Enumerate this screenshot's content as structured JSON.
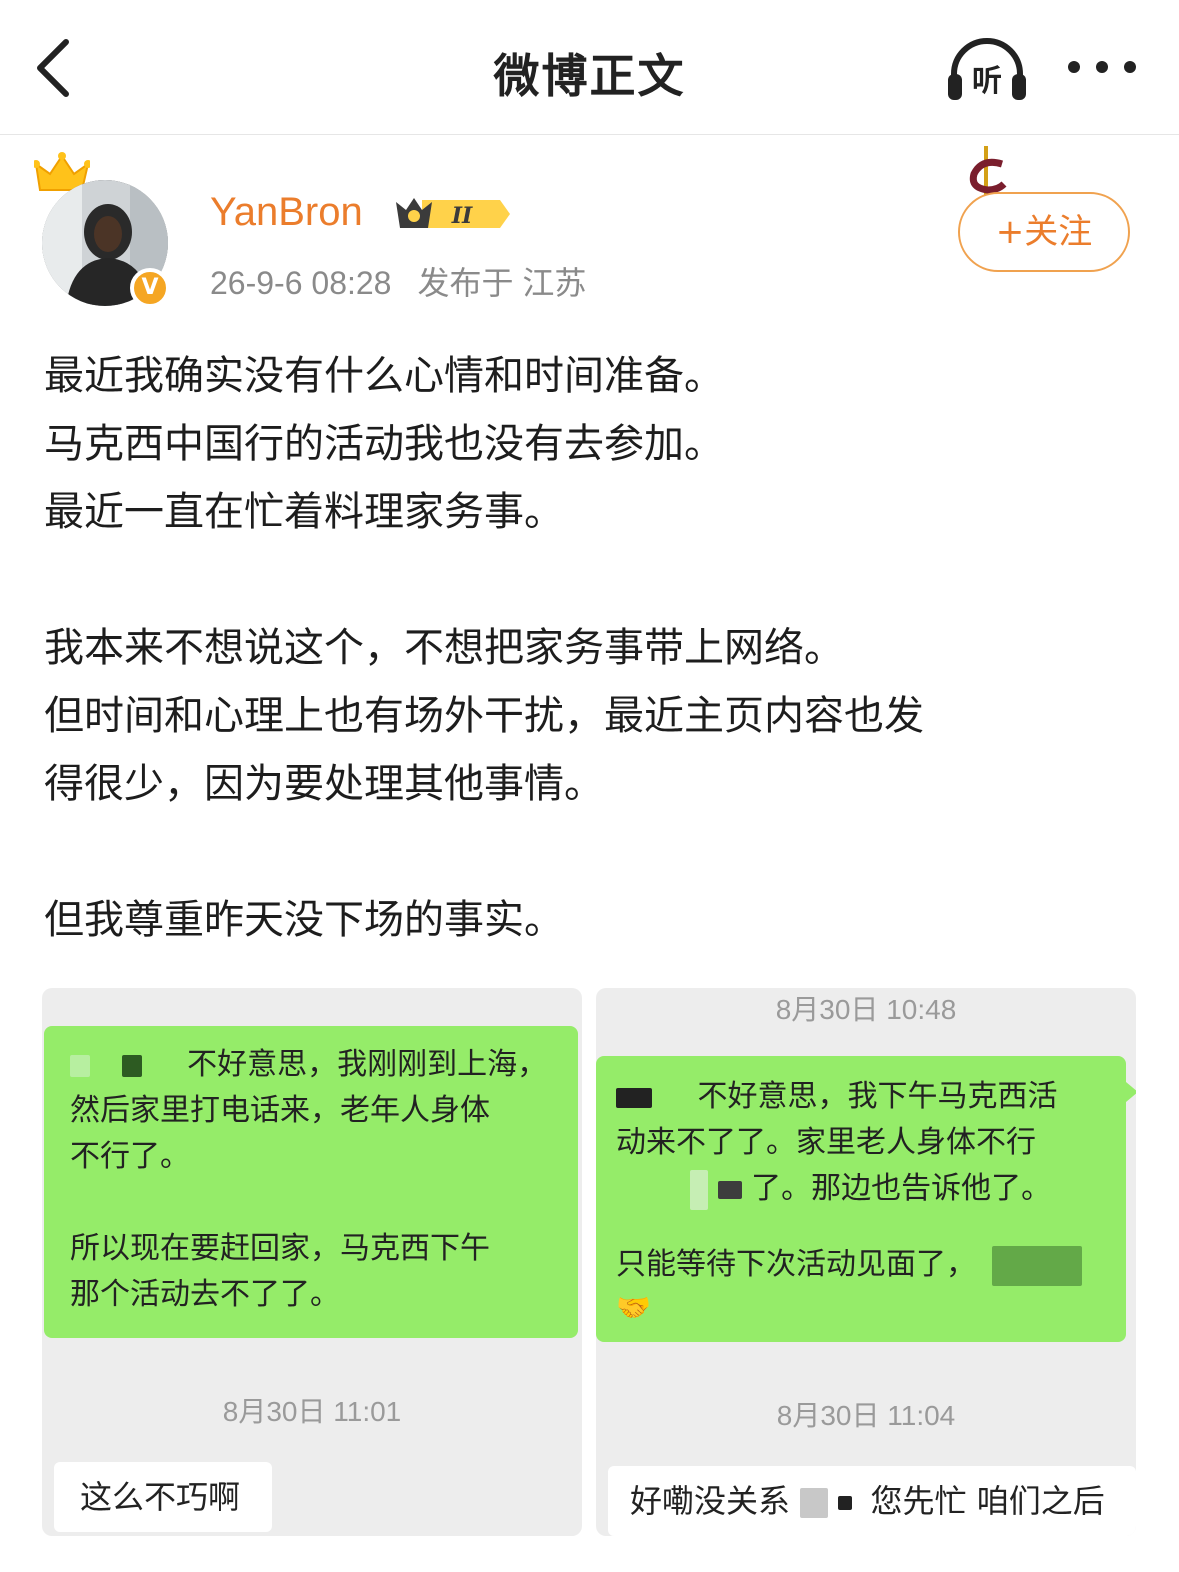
{
  "nav": {
    "title": "微博正文",
    "listen_label": "听"
  },
  "user": {
    "name": "YanBron",
    "level_badge": "II",
    "verified_mark": "V",
    "time": "26-9-6 08:28",
    "location": "发布于 江苏",
    "follow_label": "+关注"
  },
  "post": {
    "lines": [
      "最近我确实没有什么心情和时间准备。",
      "马克西中国行的活动我也没有去参加。",
      "最近一直在忙着料理家务事。",
      "",
      "我本来不想说这个，不想把家务事带上网络。",
      "但时间和心理上也有场外干扰，最近主页内容也发",
      "得很少，因为要处理其他事情。",
      "",
      "但我尊重昨天没下场的事实。"
    ]
  },
  "images": {
    "left": {
      "bubble_lines": [
        "不好意思，我刚刚到上海，",
        "然后家里打电话来，老年人身体",
        "不行了。",
        "",
        "所以现在要赶回家，马克西下午",
        "那个活动去不了了。"
      ],
      "time": "8月30日 11:01",
      "reply": "这么不巧啊"
    },
    "right": {
      "top_time": "8月30日 10:48",
      "bubble_lines": [
        "不好意思，我下午马克西活",
        "动来不了了。家里老人身体不行",
        "了。那边也告诉他了。",
        "",
        "只能等待下次活动见面了，"
      ],
      "time": "8月30日 11:04",
      "reply_a": "好嘞没关系",
      "reply_b": "您先忙 咱们之后"
    }
  },
  "colors": {
    "brand_orange": "#eb7d2c",
    "wechat_green": "#95ec69",
    "meta_gray": "#8a8a8a"
  }
}
